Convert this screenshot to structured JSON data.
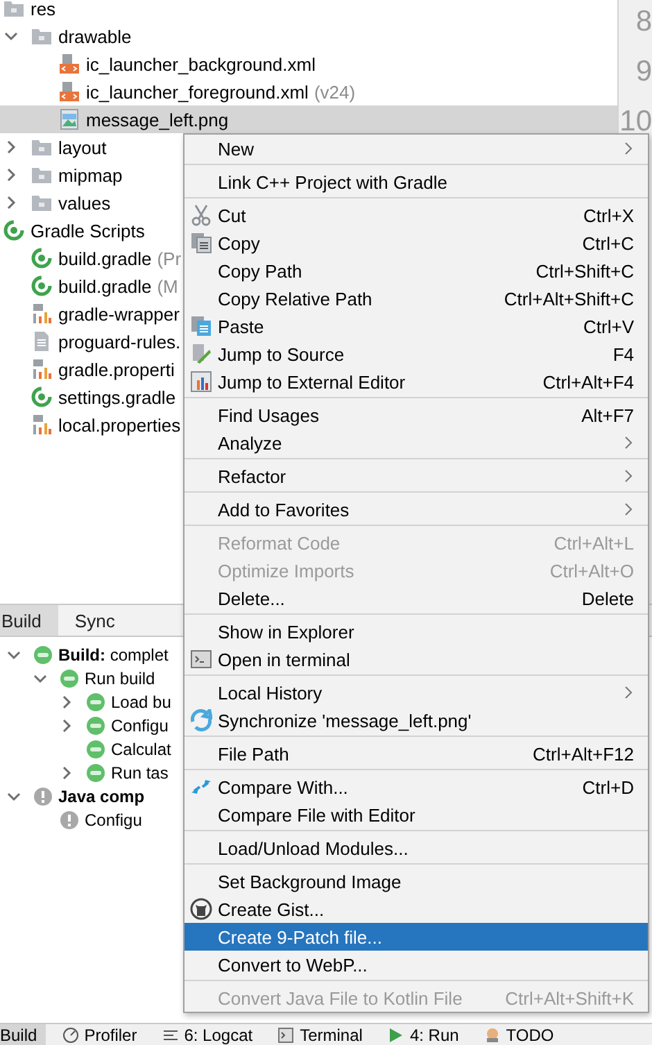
{
  "project_tree": [
    {
      "label": "res",
      "kind": "folder",
      "selected": false,
      "children": [
        {
          "label": "drawable",
          "kind": "folder",
          "expanded": true,
          "selected": false,
          "children": [
            {
              "label": "ic_launcher_background.xml",
              "kind": "xml",
              "selected": false
            },
            {
              "label": "ic_launcher_foreground.xml",
              "note": "(v24)",
              "kind": "xml",
              "selected": false
            },
            {
              "label": "message_left.png",
              "kind": "image",
              "selected": true
            }
          ]
        },
        {
          "label": "layout",
          "kind": "folder",
          "expanded": false,
          "selected": false
        },
        {
          "label": "mipmap",
          "kind": "folder",
          "expanded": false,
          "selected": false
        },
        {
          "label": "values",
          "kind": "folder",
          "expanded": false,
          "selected": false
        }
      ]
    },
    {
      "label": "Gradle Scripts",
      "kind": "gradle",
      "selected": false,
      "children": [
        {
          "label": "build.gradle",
          "note": "(Pr",
          "kind": "gradle",
          "selected": false
        },
        {
          "label": "build.gradle",
          "note": "(M",
          "kind": "gradle",
          "selected": false
        },
        {
          "label": "gradle-wrapper",
          "kind": "properties",
          "selected": false
        },
        {
          "label": "proguard-rules.",
          "kind": "text",
          "selected": false
        },
        {
          "label": "gradle.properti",
          "kind": "properties",
          "selected": false
        },
        {
          "label": "settings.gradle",
          "kind": "gradle",
          "selected": false
        },
        {
          "label": "local.properties",
          "kind": "properties",
          "selected": false
        }
      ]
    }
  ],
  "line_numbers": [
    "8",
    "9",
    "10"
  ],
  "build_panel": {
    "tabs": [
      {
        "label": "Build",
        "selected": true
      },
      {
        "label": "Sync",
        "selected": false
      }
    ],
    "tree": [
      {
        "label": "**Build:** complet",
        "kind": "ok",
        "expanded": true,
        "emphasis": false,
        "children": [
          {
            "label": "Run build",
            "kind": "ok",
            "expanded": true,
            "emphasis": false,
            "children": [
              {
                "label": "Load bu",
                "kind": "ok",
                "expanded": false,
                "emphasis": false
              },
              {
                "label": "Configu",
                "kind": "ok",
                "expanded": false,
                "emphasis": false
              },
              {
                "label": "Calculat",
                "kind": "ok",
                "emphasis": false
              },
              {
                "label": "Run tas",
                "kind": "ok",
                "expanded": false,
                "emphasis": false
              }
            ]
          }
        ]
      },
      {
        "label": "Java comp",
        "kind": "warning",
        "expanded": true,
        "emphasis": true,
        "children": [
          {
            "label": "Configu",
            "kind": "warning",
            "emphasis": false
          }
        ]
      }
    ]
  },
  "tool_tabs": [
    {
      "label": "Build",
      "kind": "plain",
      "selected": true
    },
    {
      "label": "Profiler",
      "kind": "gauge",
      "selected": false
    },
    {
      "label": "6: Logcat",
      "kind": "list",
      "selected": false
    },
    {
      "label": "Terminal",
      "kind": "terminal",
      "selected": false
    },
    {
      "label": "4: Run",
      "kind": "play",
      "selected": false
    },
    {
      "label": "TODO",
      "kind": "todo",
      "selected": false
    }
  ],
  "context_menu": {
    "groups": [
      [
        {
          "label": "New",
          "submenu": true,
          "disabled": false,
          "selected": false
        }
      ],
      [
        {
          "label": "Link C++ Project with Gradle",
          "submenu": false,
          "disabled": false,
          "selected": false
        }
      ],
      [
        {
          "label": "Cut",
          "shortcut": "Ctrl+X",
          "kind": "cut",
          "submenu": false,
          "disabled": false,
          "selected": false
        },
        {
          "label": "Copy",
          "shortcut": "Ctrl+C",
          "kind": "copy",
          "submenu": false,
          "disabled": false,
          "selected": false
        },
        {
          "label": "Copy Path",
          "shortcut": "Ctrl+Shift+C",
          "submenu": false,
          "disabled": false,
          "selected": false
        },
        {
          "label": "Copy Relative Path",
          "shortcut": "Ctrl+Alt+Shift+C",
          "submenu": false,
          "disabled": false,
          "selected": false
        },
        {
          "label": "Paste",
          "shortcut": "Ctrl+V",
          "kind": "paste",
          "submenu": false,
          "disabled": false,
          "selected": false
        },
        {
          "label": "Jump to Source",
          "shortcut": "F4",
          "kind": "edit",
          "submenu": false,
          "disabled": false,
          "selected": false
        },
        {
          "label": "Jump to External Editor",
          "shortcut": "Ctrl+Alt+F4",
          "kind": "external",
          "submenu": false,
          "disabled": false,
          "selected": false
        }
      ],
      [
        {
          "label": "Find Usages",
          "shortcut": "Alt+F7",
          "submenu": false,
          "disabled": false,
          "selected": false
        },
        {
          "label": "Analyze",
          "submenu": true,
          "disabled": false,
          "selected": false
        }
      ],
      [
        {
          "label": "Refactor",
          "submenu": true,
          "disabled": false,
          "selected": false
        }
      ],
      [
        {
          "label": "Add to Favorites",
          "submenu": true,
          "disabled": false,
          "selected": false
        }
      ],
      [
        {
          "label": "Reformat Code",
          "shortcut": "Ctrl+Alt+L",
          "submenu": false,
          "disabled": true,
          "selected": false
        },
        {
          "label": "Optimize Imports",
          "shortcut": "Ctrl+Alt+O",
          "submenu": false,
          "disabled": true,
          "selected": false
        },
        {
          "label": "Delete...",
          "shortcut": "Delete",
          "submenu": false,
          "disabled": false,
          "selected": false
        }
      ],
      [
        {
          "label": "Show in Explorer",
          "submenu": false,
          "disabled": false,
          "selected": false
        },
        {
          "label": "Open in terminal",
          "kind": "terminal",
          "submenu": false,
          "disabled": false,
          "selected": false
        }
      ],
      [
        {
          "label": "Local History",
          "submenu": true,
          "disabled": false,
          "selected": false
        },
        {
          "label": "Synchronize 'message_left.png'",
          "kind": "sync",
          "submenu": false,
          "disabled": false,
          "selected": false
        }
      ],
      [
        {
          "label": "File Path",
          "shortcut": "Ctrl+Alt+F12",
          "submenu": false,
          "disabled": false,
          "selected": false
        }
      ],
      [
        {
          "label": "Compare With...",
          "shortcut": "Ctrl+D",
          "kind": "compare",
          "submenu": false,
          "disabled": false,
          "selected": false
        },
        {
          "label": "Compare File with Editor",
          "submenu": false,
          "disabled": false,
          "selected": false
        }
      ],
      [
        {
          "label": "Load/Unload Modules...",
          "submenu": false,
          "disabled": false,
          "selected": false
        }
      ],
      [
        {
          "label": "Set Background Image",
          "submenu": false,
          "disabled": false,
          "selected": false
        },
        {
          "label": "Create Gist...",
          "kind": "gist",
          "submenu": false,
          "disabled": false,
          "selected": false
        },
        {
          "label": "Create 9-Patch file...",
          "submenu": false,
          "disabled": false,
          "selected": true
        },
        {
          "label": "Convert to WebP...",
          "submenu": false,
          "disabled": false,
          "selected": false
        }
      ],
      [
        {
          "label": "Convert Java File to Kotlin File",
          "shortcut": "Ctrl+Alt+Shift+K",
          "submenu": false,
          "disabled": true,
          "selected": false
        }
      ]
    ]
  }
}
